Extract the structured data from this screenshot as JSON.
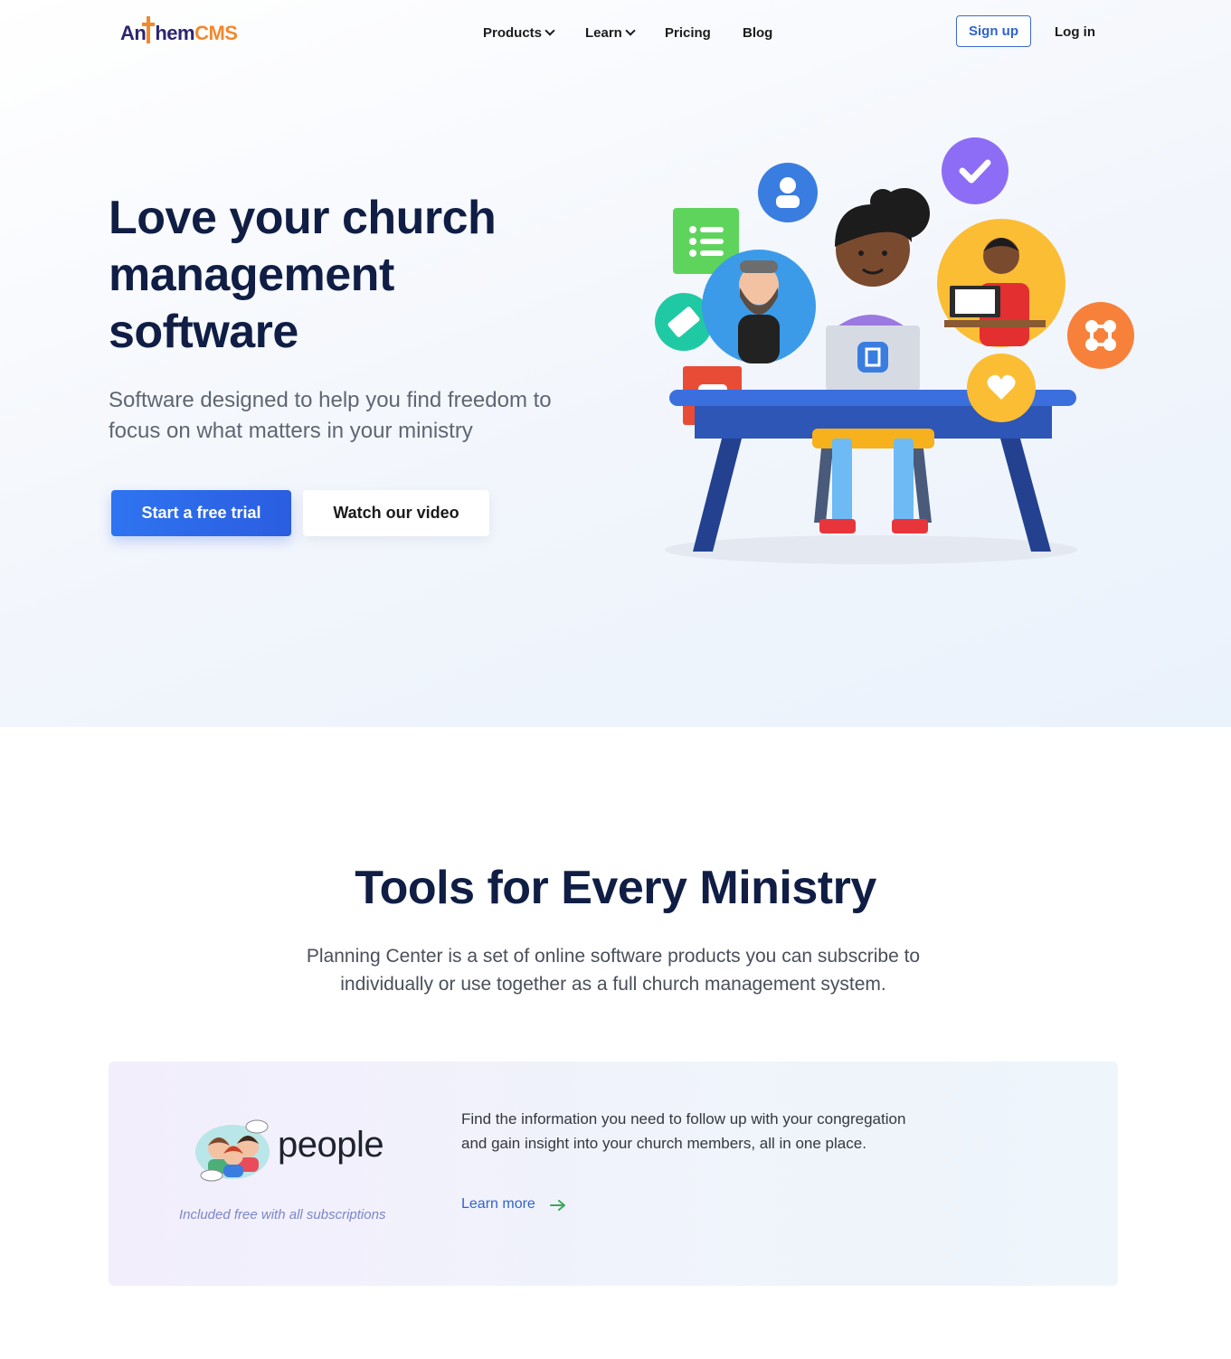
{
  "header": {
    "logo": {
      "part1": "An",
      "part2": "hem",
      "part3": "CMS"
    },
    "nav": [
      {
        "label": "Products",
        "has_dropdown": true,
        "icon": "chevron-down-icon"
      },
      {
        "label": "Learn",
        "has_dropdown": true,
        "icon": "chevron-down-icon"
      },
      {
        "label": "Pricing",
        "has_dropdown": false
      },
      {
        "label": "Blog",
        "has_dropdown": false
      }
    ],
    "signup_label": "Sign up",
    "login_label": "Log in"
  },
  "hero": {
    "title_line1": "Love your church",
    "title_line2": "management",
    "title_line3": "software",
    "subtitle": "Software designed to help you find freedom to focus on what matters in your ministry",
    "cta_primary": "Start a free trial",
    "cta_secondary": "Watch our video",
    "illustration_icons": [
      "list-icon",
      "user-icon",
      "check-icon",
      "ticket-icon",
      "calendar-icon",
      "heart-icon",
      "groups-icon",
      "laptop-logo-icon"
    ]
  },
  "tools": {
    "title": "Tools for Every Ministry",
    "subtitle": "Planning Center is a set of online software products you can subscribe to individually or use together as a full church management system.",
    "product": {
      "name": "people",
      "note": "Included free with all subscriptions",
      "description": "Find the information you need to follow up with your congregation and gain insight into your church members, all in one place.",
      "link_label": "Learn more",
      "link_icon": "arrow-right-icon"
    }
  },
  "colors": {
    "primary": "#2b5de0",
    "heading": "#101e45",
    "logo_dark": "#2c2470",
    "logo_accent": "#f1892d",
    "link_arrow": "#3aa65c"
  }
}
